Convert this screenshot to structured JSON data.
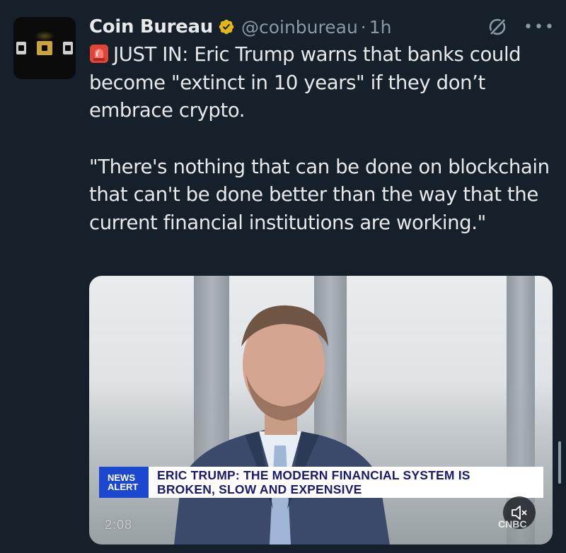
{
  "author": {
    "name": "Coin Bureau",
    "handle": "@coinbureau",
    "separator": "·",
    "time": "1h",
    "verified": true
  },
  "icons": {
    "verified": "verified-badge-icon",
    "grok": "grok-icon",
    "more": "more-icon",
    "siren": "siren-emoji-icon",
    "mute": "mute-icon"
  },
  "tweet": {
    "line1": "JUST IN:  Eric Trump warns that banks could become \"extinct in 10 years\" if they don’t embrace crypto.",
    "line2": "\"There's nothing that can be done on blockchain that can't be done better than the way that the current financial institutions are working.\""
  },
  "video": {
    "badge_line1": "NEWS",
    "badge_line2": "ALERT",
    "headline_line1": "ERIC TRUMP: THE MODERN FINANCIAL SYSTEM IS",
    "headline_line2": "BROKEN, SLOW AND EXPENSIVE",
    "timestamp": "2:08",
    "network": "CNBC"
  },
  "colors": {
    "background": "#15202b",
    "text": "#e7e9ea",
    "muted": "#8b98a5",
    "verified_gold": "#e2b719",
    "news_blue": "#1b47d1"
  }
}
